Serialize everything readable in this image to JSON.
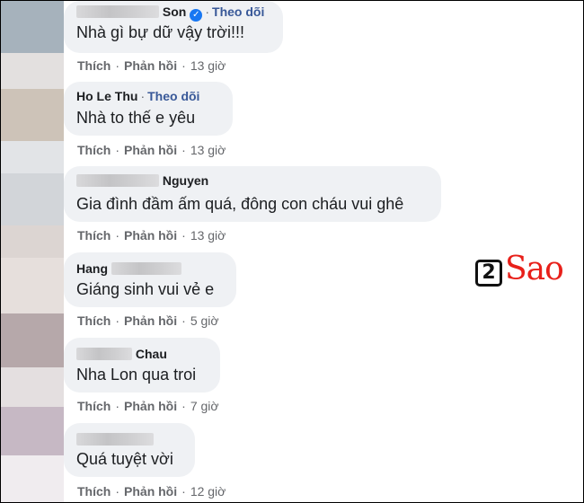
{
  "actions": {
    "like_label": "Thích",
    "reply_label": "Phản hồi",
    "separator": "·"
  },
  "comments": [
    {
      "author_suffix": "Son",
      "verified": true,
      "follow_label": "Theo dõi",
      "text": "Nhà gì bự dữ vậy trời!!!",
      "time": "13 giờ"
    },
    {
      "author": "Ho Le Thu",
      "follow_label": "Theo dõi",
      "text": "Nhà to thế e yêu",
      "time": "13 giờ"
    },
    {
      "author_suffix": "Nguyen",
      "text": "Gia đình đầm ấm quá, đông con cháu vui ghê",
      "time": "13 giờ"
    },
    {
      "author_prefix": "Hang",
      "text": "Giáng sinh vui vẻ e",
      "time": "5 giờ"
    },
    {
      "author_suffix": "Chau",
      "text": "Nha Lon qua troi",
      "time": "7 giờ"
    },
    {
      "text": "Quá tuyệt vời",
      "time": "12 giờ"
    }
  ],
  "watermark": {
    "digit": "2",
    "word": "Sao",
    "accent_color": "#e8201a"
  },
  "colors": {
    "bubble": "#eff1f4",
    "link": "#385898",
    "meta": "#65676b",
    "verified": "#1877f2"
  }
}
